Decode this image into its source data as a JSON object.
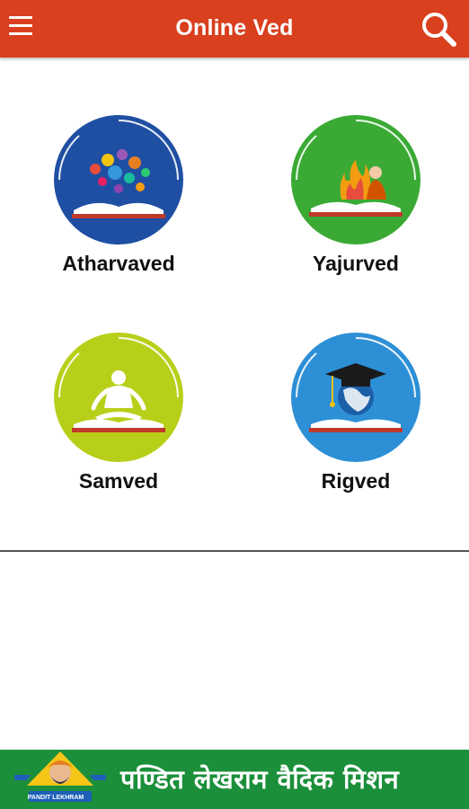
{
  "app_bar": {
    "title": "Online Ved",
    "menu_icon": "hamburger-menu-icon",
    "search_icon": "search-icon",
    "color": "#d9401e"
  },
  "veds": [
    {
      "label": "Atharvaved",
      "icon": "book-with-symbols-icon",
      "color": "#1f4fa3"
    },
    {
      "label": "Yajurved",
      "icon": "book-with-yajna-icon",
      "color": "#3aaa35"
    },
    {
      "label": "Samved",
      "icon": "book-with-meditation-icon",
      "color": "#b8cf1a"
    },
    {
      "label": "Rigved",
      "icon": "book-with-graduation-cap-icon",
      "color": "#2d8fd5"
    }
  ],
  "footer": {
    "logo_caption": "PANDIT LEKHRAM",
    "text": "पण्डित लेखराम वैदिक मिशन",
    "color": "#1b8f3a"
  }
}
